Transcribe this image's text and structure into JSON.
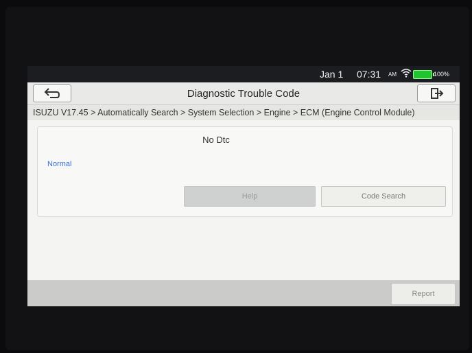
{
  "status_bar": {
    "date": "Jan 1",
    "time": "07:31",
    "am_pm": "AM",
    "battery": "100%",
    "wifi_icon": "wifi-icon"
  },
  "header": {
    "title": "Diagnostic Trouble Code",
    "back_icon": "back-icon",
    "exit_icon": "exit-icon"
  },
  "breadcrumb": "ISUZU V17.45 > Automatically Search > System Selection > Engine > ECM (Engine Control Module)",
  "result": {
    "dtc_text": "No Dtc",
    "status": "Normal",
    "status_color": "#3a6fd1",
    "help_label": "Help",
    "code_search_label": "Code Search"
  },
  "footer": {
    "report_label": "Report"
  },
  "colors": {
    "battery": "#22c32e"
  }
}
